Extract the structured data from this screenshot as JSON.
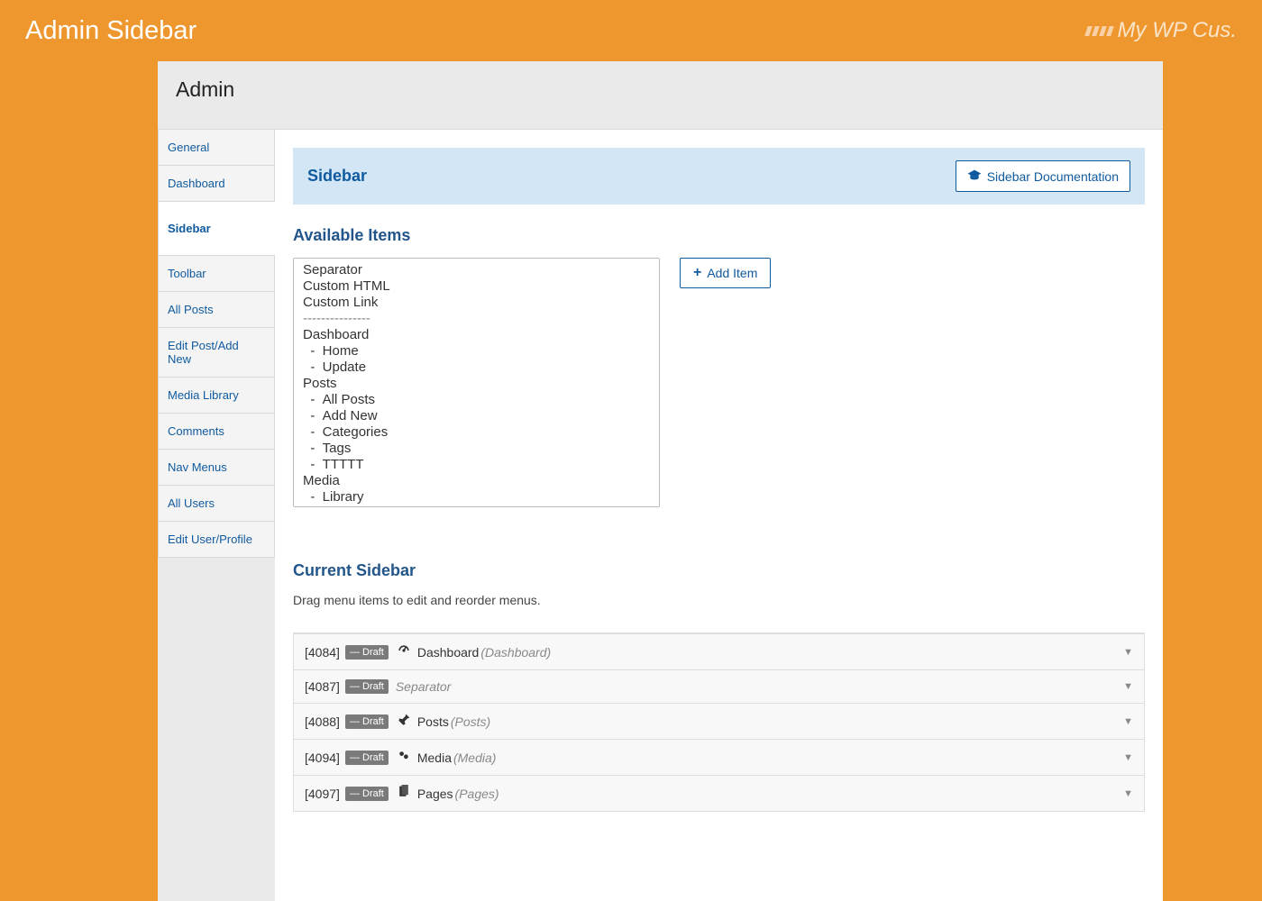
{
  "topbar": {
    "title": "Admin Sidebar",
    "brand": "My WP Cus."
  },
  "panel": {
    "heading": "Admin"
  },
  "subnav": {
    "items": [
      {
        "label": "General"
      },
      {
        "label": "Dashboard"
      },
      {
        "label": "Sidebar",
        "active": true
      },
      {
        "label": "Toolbar"
      },
      {
        "label": "All Posts"
      },
      {
        "label": "Edit Post/Add New"
      },
      {
        "label": "Media Library"
      },
      {
        "label": "Comments"
      },
      {
        "label": "Nav Menus"
      },
      {
        "label": "All Users"
      },
      {
        "label": "Edit User/Profile"
      }
    ]
  },
  "banner": {
    "title": "Sidebar",
    "docButton": "Sidebar Documentation"
  },
  "sections": {
    "available": "Available Items",
    "addButton": "Add Item",
    "current": "Current Sidebar",
    "hint": "Drag menu items to edit and reorder menus."
  },
  "availableItems": [
    "Separator",
    "Custom HTML",
    "Custom Link",
    "---------------",
    "Dashboard",
    "  -  Home",
    "  -  Update",
    "Posts",
    "  -  All Posts",
    "  -  Add New",
    "  -  Categories",
    "  -  Tags",
    "  -  TTTTT",
    "Media",
    "  -  Library"
  ],
  "draftLabel": "— Draft",
  "rows": [
    {
      "id": "[4084]",
      "icon": "dash",
      "label": "Dashboard",
      "sub": "(Dashboard)"
    },
    {
      "id": "[4087]",
      "sep": true,
      "label": "Separator"
    },
    {
      "id": "[4088]",
      "icon": "pin",
      "label": "Posts",
      "sub": "(Posts)"
    },
    {
      "id": "[4094]",
      "icon": "media",
      "label": "Media",
      "sub": "(Media)"
    },
    {
      "id": "[4097]",
      "icon": "page",
      "label": "Pages",
      "sub": "(Pages)"
    }
  ]
}
